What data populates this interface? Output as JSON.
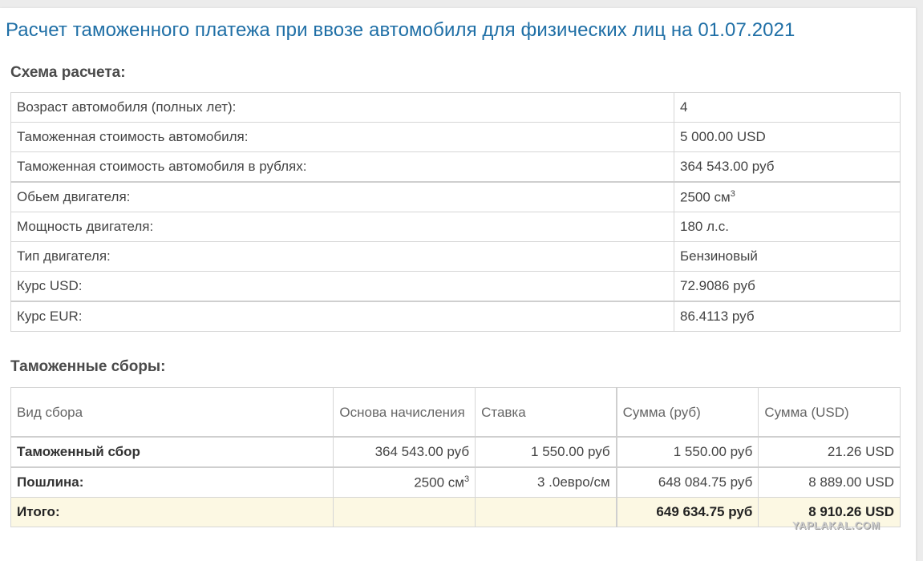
{
  "page_title": "Расчет таможенного платежа при ввозе автомобиля для физических лиц на 01.07.2021",
  "scheme": {
    "title": "Схема расчета:",
    "rows": [
      {
        "label": "Возраст автомобиля (полных лет):",
        "value": "4"
      },
      {
        "label": "Таможенная стоимость автомобиля:",
        "value": "5 000.00 USD"
      },
      {
        "label": "Таможенная стоимость автомобиля в рублях:",
        "value": "364 543.00 руб"
      },
      {
        "label": "Обьем двигателя:",
        "value": "2500 см",
        "sup": "3"
      },
      {
        "label": "Мощность двигателя:",
        "value": "180 л.с."
      },
      {
        "label": "Тип двигателя:",
        "value": "Бензиновый"
      },
      {
        "label": "Курс USD:",
        "value": "72.9086 руб"
      },
      {
        "label": "Курс EUR:",
        "value": "86.4113 руб"
      }
    ]
  },
  "fees": {
    "title": "Таможенные сборы:",
    "headers": [
      "Вид сбора",
      "Основа начисления",
      "Ставка",
      "Сумма (руб)",
      "Сумма (USD)"
    ],
    "rows": [
      {
        "name": "Таможенный сбор",
        "base": "364 543.00 руб",
        "rate": "1 550.00 руб",
        "rub": "1 550.00 руб",
        "usd": "21.26 USD"
      },
      {
        "name": "Пошлина:",
        "base": "2500 см",
        "base_sup": "3",
        "rate": "3 .0евро/см",
        "rub": "648 084.75 руб",
        "usd": "8 889.00 USD"
      }
    ],
    "total": {
      "name": "Итого:",
      "rub": "649 634.75 руб",
      "usd": "8 910.26 USD"
    }
  },
  "watermark": "YAPLAKAL.COM",
  "colors": {
    "title": "#1f6fa6",
    "total_row_bg": "#fcf8e3",
    "border": "#d6d6d6"
  }
}
